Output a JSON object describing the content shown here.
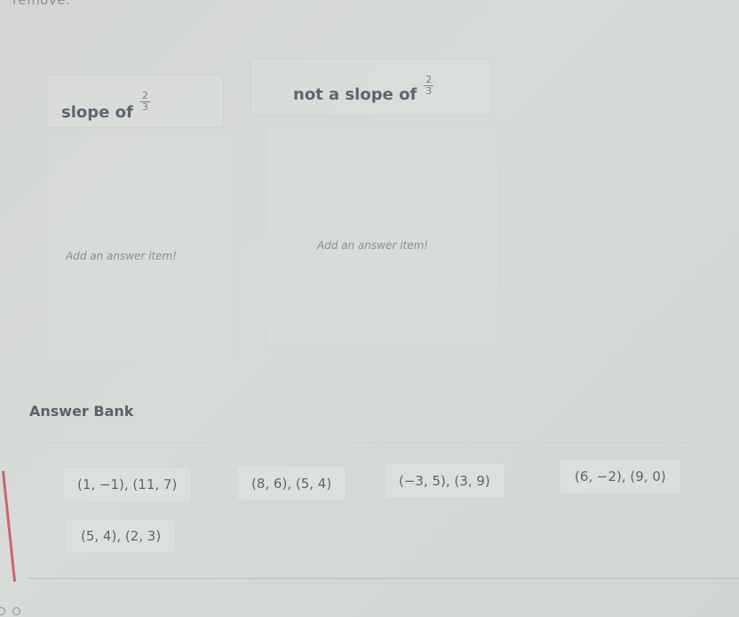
{
  "top_partial_text": "remove.",
  "categories": [
    {
      "title": "slope of",
      "fraction": {
        "numerator": "2",
        "denominator": "3"
      },
      "placeholder": "Add an answer item!"
    },
    {
      "title": "not a slope of",
      "fraction": {
        "numerator": "2",
        "denominator": "3"
      },
      "placeholder": "Add an answer item!"
    }
  ],
  "answer_bank": {
    "title": "Answer Bank",
    "items": [
      {
        "label": "(1, −1), (11, 7)"
      },
      {
        "label": "(8, 6), (5, 4)"
      },
      {
        "label": "(−3, 5), (3, 9)"
      },
      {
        "label": "(6, −2), (9, 0)"
      },
      {
        "label": "(5, 4), (2, 3)"
      }
    ]
  },
  "colors": {
    "background": "#d5d9d6",
    "text": "#5b6168",
    "accent_line": "#c9666e"
  }
}
